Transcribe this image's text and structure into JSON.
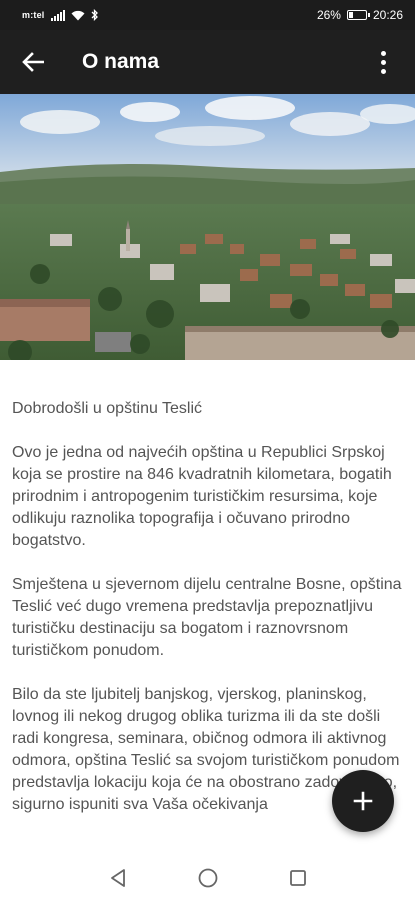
{
  "status_bar": {
    "carrier": "m:tel",
    "battery_text": "26%",
    "battery_level": 0.26,
    "time": "20:26"
  },
  "app_bar": {
    "title": "O nama",
    "back_icon": "arrow-left-icon",
    "menu_icon": "more-vert-icon"
  },
  "hero_image": {
    "alt": "Aerial view of Teslić"
  },
  "content": {
    "heading": "Dobrodošli u opštinu Teslić",
    "paragraphs": [
      "Ovo je jedna od najvećih opština u Republici Srpskoj koja se prostire na 846 kvadratnih kilometara, bogatih prirodnim i antropogenim turističkim resursima, koje odlikuju raznolika topografija i očuvano prirodno bogatstvo.",
      "Smještena u sjevernom dijelu centralne Bosne, opština Teslić već dugo vremena predstavlja prepoznatljivu turističku destinaciju sa bogatom i raznovrsnom turističkom ponudom.",
      "Bilo da ste ljubitelj banjskog, vjerskog, planinskog, lovnog ili nekog drugog oblika turizma ili da ste došli radi kongresa, seminara, običnog odmora ili aktivnog odmora, opština Teslić sa svojom turističkom ponudom predstavlja lokaciju koja će na obostrano zadovoljstvo, sigurno ispuniti sva Vaša očekivanja"
    ]
  },
  "fab": {
    "icon": "plus-icon"
  },
  "nav_bar": {
    "back_icon": "triangle-back-icon",
    "home_icon": "circle-home-icon",
    "recents_icon": "square-recents-icon"
  }
}
